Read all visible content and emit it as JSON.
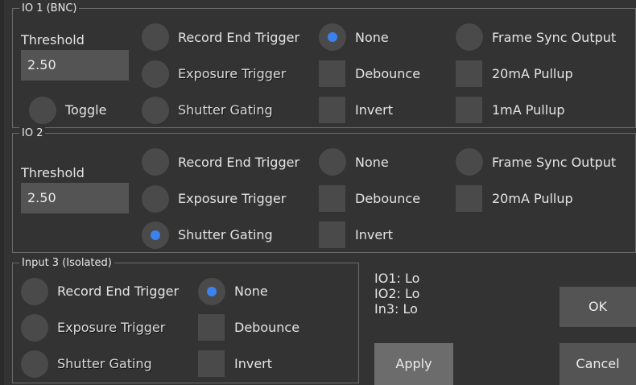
{
  "io1": {
    "title": "IO 1 (BNC)",
    "threshold_label": "Threshold",
    "threshold_value": "2.50",
    "toggle": "Toggle",
    "record_end": "Record End Trigger",
    "exposure": "Exposure Trigger",
    "shutter": "Shutter Gating",
    "none": "None",
    "debounce": "Debounce",
    "invert": "Invert",
    "frame_sync": "Frame Sync Output",
    "pullup20": "20mA Pullup",
    "pullup1": "1mA Pullup"
  },
  "io2": {
    "title": "IO 2",
    "threshold_label": "Threshold",
    "threshold_value": "2.50",
    "record_end": "Record End Trigger",
    "exposure": "Exposure Trigger",
    "shutter": "Shutter Gating",
    "none": "None",
    "debounce": "Debounce",
    "invert": "Invert",
    "frame_sync": "Frame Sync Output",
    "pullup20": "20mA Pullup"
  },
  "in3": {
    "title": "Input 3 (Isolated)",
    "record_end": "Record End Trigger",
    "exposure": "Exposure Trigger",
    "shutter": "Shutter Gating",
    "none": "None",
    "debounce": "Debounce",
    "invert": "Invert"
  },
  "status": {
    "io1": "IO1: Lo",
    "io2": "IO2: Lo",
    "in3": "In3: Lo"
  },
  "buttons": {
    "ok": "OK",
    "apply": "Apply",
    "cancel": "Cancel"
  },
  "colors": {
    "accent": "#3b82f0",
    "background": "#333333",
    "control": "#4a4a4a"
  }
}
